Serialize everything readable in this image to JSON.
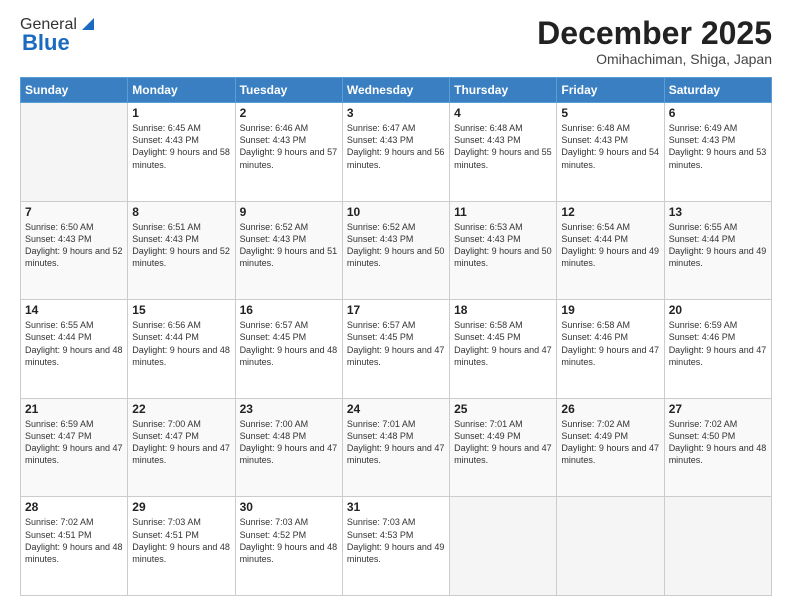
{
  "logo": {
    "general": "General",
    "blue": "Blue"
  },
  "header": {
    "month": "December 2025",
    "location": "Omihachiman, Shiga, Japan"
  },
  "days_of_week": [
    "Sunday",
    "Monday",
    "Tuesday",
    "Wednesday",
    "Thursday",
    "Friday",
    "Saturday"
  ],
  "weeks": [
    [
      {
        "day": "",
        "empty": true
      },
      {
        "day": "1",
        "sunrise": "Sunrise: 6:45 AM",
        "sunset": "Sunset: 4:43 PM",
        "daylight": "Daylight: 9 hours and 58 minutes."
      },
      {
        "day": "2",
        "sunrise": "Sunrise: 6:46 AM",
        "sunset": "Sunset: 4:43 PM",
        "daylight": "Daylight: 9 hours and 57 minutes."
      },
      {
        "day": "3",
        "sunrise": "Sunrise: 6:47 AM",
        "sunset": "Sunset: 4:43 PM",
        "daylight": "Daylight: 9 hours and 56 minutes."
      },
      {
        "day": "4",
        "sunrise": "Sunrise: 6:48 AM",
        "sunset": "Sunset: 4:43 PM",
        "daylight": "Daylight: 9 hours and 55 minutes."
      },
      {
        "day": "5",
        "sunrise": "Sunrise: 6:48 AM",
        "sunset": "Sunset: 4:43 PM",
        "daylight": "Daylight: 9 hours and 54 minutes."
      },
      {
        "day": "6",
        "sunrise": "Sunrise: 6:49 AM",
        "sunset": "Sunset: 4:43 PM",
        "daylight": "Daylight: 9 hours and 53 minutes."
      }
    ],
    [
      {
        "day": "7",
        "sunrise": "Sunrise: 6:50 AM",
        "sunset": "Sunset: 4:43 PM",
        "daylight": "Daylight: 9 hours and 52 minutes."
      },
      {
        "day": "8",
        "sunrise": "Sunrise: 6:51 AM",
        "sunset": "Sunset: 4:43 PM",
        "daylight": "Daylight: 9 hours and 52 minutes."
      },
      {
        "day": "9",
        "sunrise": "Sunrise: 6:52 AM",
        "sunset": "Sunset: 4:43 PM",
        "daylight": "Daylight: 9 hours and 51 minutes."
      },
      {
        "day": "10",
        "sunrise": "Sunrise: 6:52 AM",
        "sunset": "Sunset: 4:43 PM",
        "daylight": "Daylight: 9 hours and 50 minutes."
      },
      {
        "day": "11",
        "sunrise": "Sunrise: 6:53 AM",
        "sunset": "Sunset: 4:43 PM",
        "daylight": "Daylight: 9 hours and 50 minutes."
      },
      {
        "day": "12",
        "sunrise": "Sunrise: 6:54 AM",
        "sunset": "Sunset: 4:44 PM",
        "daylight": "Daylight: 9 hours and 49 minutes."
      },
      {
        "day": "13",
        "sunrise": "Sunrise: 6:55 AM",
        "sunset": "Sunset: 4:44 PM",
        "daylight": "Daylight: 9 hours and 49 minutes."
      }
    ],
    [
      {
        "day": "14",
        "sunrise": "Sunrise: 6:55 AM",
        "sunset": "Sunset: 4:44 PM",
        "daylight": "Daylight: 9 hours and 48 minutes."
      },
      {
        "day": "15",
        "sunrise": "Sunrise: 6:56 AM",
        "sunset": "Sunset: 4:44 PM",
        "daylight": "Daylight: 9 hours and 48 minutes."
      },
      {
        "day": "16",
        "sunrise": "Sunrise: 6:57 AM",
        "sunset": "Sunset: 4:45 PM",
        "daylight": "Daylight: 9 hours and 48 minutes."
      },
      {
        "day": "17",
        "sunrise": "Sunrise: 6:57 AM",
        "sunset": "Sunset: 4:45 PM",
        "daylight": "Daylight: 9 hours and 47 minutes."
      },
      {
        "day": "18",
        "sunrise": "Sunrise: 6:58 AM",
        "sunset": "Sunset: 4:45 PM",
        "daylight": "Daylight: 9 hours and 47 minutes."
      },
      {
        "day": "19",
        "sunrise": "Sunrise: 6:58 AM",
        "sunset": "Sunset: 4:46 PM",
        "daylight": "Daylight: 9 hours and 47 minutes."
      },
      {
        "day": "20",
        "sunrise": "Sunrise: 6:59 AM",
        "sunset": "Sunset: 4:46 PM",
        "daylight": "Daylight: 9 hours and 47 minutes."
      }
    ],
    [
      {
        "day": "21",
        "sunrise": "Sunrise: 6:59 AM",
        "sunset": "Sunset: 4:47 PM",
        "daylight": "Daylight: 9 hours and 47 minutes."
      },
      {
        "day": "22",
        "sunrise": "Sunrise: 7:00 AM",
        "sunset": "Sunset: 4:47 PM",
        "daylight": "Daylight: 9 hours and 47 minutes."
      },
      {
        "day": "23",
        "sunrise": "Sunrise: 7:00 AM",
        "sunset": "Sunset: 4:48 PM",
        "daylight": "Daylight: 9 hours and 47 minutes."
      },
      {
        "day": "24",
        "sunrise": "Sunrise: 7:01 AM",
        "sunset": "Sunset: 4:48 PM",
        "daylight": "Daylight: 9 hours and 47 minutes."
      },
      {
        "day": "25",
        "sunrise": "Sunrise: 7:01 AM",
        "sunset": "Sunset: 4:49 PM",
        "daylight": "Daylight: 9 hours and 47 minutes."
      },
      {
        "day": "26",
        "sunrise": "Sunrise: 7:02 AM",
        "sunset": "Sunset: 4:49 PM",
        "daylight": "Daylight: 9 hours and 47 minutes."
      },
      {
        "day": "27",
        "sunrise": "Sunrise: 7:02 AM",
        "sunset": "Sunset: 4:50 PM",
        "daylight": "Daylight: 9 hours and 48 minutes."
      }
    ],
    [
      {
        "day": "28",
        "sunrise": "Sunrise: 7:02 AM",
        "sunset": "Sunset: 4:51 PM",
        "daylight": "Daylight: 9 hours and 48 minutes."
      },
      {
        "day": "29",
        "sunrise": "Sunrise: 7:03 AM",
        "sunset": "Sunset: 4:51 PM",
        "daylight": "Daylight: 9 hours and 48 minutes."
      },
      {
        "day": "30",
        "sunrise": "Sunrise: 7:03 AM",
        "sunset": "Sunset: 4:52 PM",
        "daylight": "Daylight: 9 hours and 48 minutes."
      },
      {
        "day": "31",
        "sunrise": "Sunrise: 7:03 AM",
        "sunset": "Sunset: 4:53 PM",
        "daylight": "Daylight: 9 hours and 49 minutes."
      },
      {
        "day": "",
        "empty": true
      },
      {
        "day": "",
        "empty": true
      },
      {
        "day": "",
        "empty": true
      }
    ]
  ]
}
